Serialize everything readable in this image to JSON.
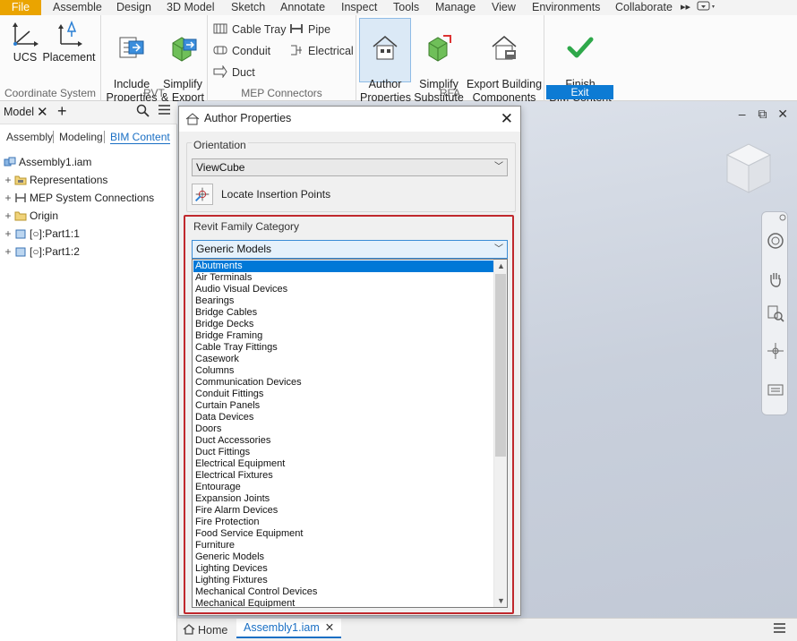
{
  "menubar": {
    "tabs": [
      "File",
      "Assemble",
      "Design",
      "3D Model",
      "Sketch",
      "Annotate",
      "Inspect",
      "Tools",
      "Manage",
      "View",
      "Environments",
      "Collaborate"
    ],
    "overflow_icon": "double-chevron-right-icon"
  },
  "ribbon": {
    "coordinate_system": {
      "title": "Coordinate System",
      "ucs": "UCS",
      "placement": "Placement"
    },
    "rvt": {
      "title": "RVT",
      "include": "Include\nProperties",
      "simplify_export": "Simplify\n& Export"
    },
    "mep": {
      "title": "MEP Connectors",
      "cable_tray": "Cable Tray",
      "conduit": "Conduit",
      "duct": "Duct",
      "pipe": "Pipe",
      "electrical": "Electrical"
    },
    "rfa": {
      "title": "RFA",
      "author_properties": "Author\nProperties",
      "simplify_substitute": "Simplify\nSubstitute",
      "export_building": "Export Building\nComponents"
    },
    "exit": {
      "title": "Exit",
      "finish": "Finish\nBIM Content"
    }
  },
  "browser": {
    "header_label": "Model",
    "tabs": [
      "Assembly",
      "Modeling",
      "BIM Content"
    ],
    "active_tab": "BIM Content",
    "tree": [
      {
        "label": "Assembly1.iam",
        "icon": "assembly-icon",
        "expander": ""
      },
      {
        "label": "Representations",
        "icon": "folder-icon",
        "expander": "+"
      },
      {
        "label": "MEP System Connections",
        "icon": "connections-icon",
        "expander": "+"
      },
      {
        "label": "Origin",
        "icon": "folder-icon",
        "expander": "+"
      },
      {
        "label": "[○]:Part1:1",
        "icon": "part-icon",
        "expander": "+"
      },
      {
        "label": "[○]:Part1:2",
        "icon": "part-icon",
        "expander": "+"
      }
    ]
  },
  "doc_tabs": {
    "home": "Home",
    "active": "Assembly1.iam"
  },
  "dialog": {
    "title": "Author Properties",
    "orientation": {
      "label": "Orientation",
      "value": "ViewCube",
      "locate_label": "Locate Insertion Points"
    },
    "revit": {
      "label": "Revit Family Category",
      "value": "Generic Models",
      "options": [
        "Abutments",
        "Air Terminals",
        "Audio Visual Devices",
        "Bearings",
        "Bridge Cables",
        "Bridge Decks",
        "Bridge Framing",
        "Cable Tray Fittings",
        "Casework",
        "Columns",
        "Communication Devices",
        "Conduit Fittings",
        "Curtain Panels",
        "Data Devices",
        "Doors",
        "Duct Accessories",
        "Duct Fittings",
        "Electrical Equipment",
        "Electrical Fixtures",
        "Entourage",
        "Expansion Joints",
        "Fire Alarm Devices",
        "Fire Protection",
        "Food Service Equipment",
        "Furniture",
        "Generic Models",
        "Lighting Devices",
        "Lighting Fixtures",
        "Mechanical Control Devices",
        "Mechanical Equipment"
      ],
      "highlighted": "Abutments"
    }
  },
  "colors": {
    "file_tab": "#eaa400",
    "accent": "#0078d7",
    "exit_bar": "#0d7bd4",
    "highlight_border": "#c0282d"
  }
}
